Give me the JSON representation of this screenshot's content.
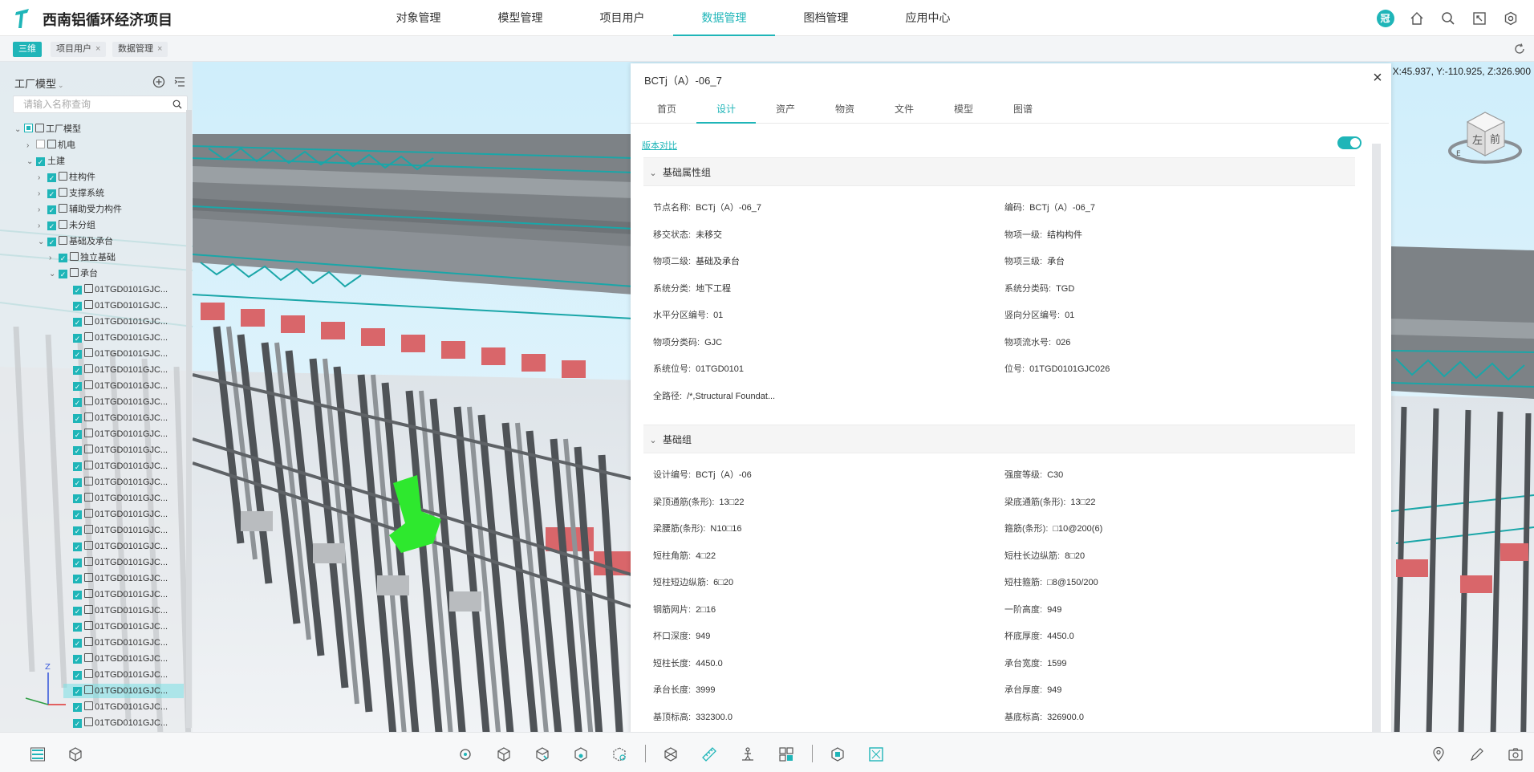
{
  "app": {
    "title": "西南铝循环经济项目"
  },
  "nav": {
    "items": [
      "对象管理",
      "模型管理",
      "项目用户",
      "数据管理",
      "图档管理",
      "应用中心"
    ],
    "active": 3
  },
  "user": {
    "badge": "冠"
  },
  "page_tabs": [
    {
      "label": "三维",
      "active": true
    },
    {
      "label": "项目用户",
      "active": false,
      "close": "×"
    },
    {
      "label": "数据管理",
      "active": false,
      "close": "×"
    }
  ],
  "viewer": {
    "coords": "X:45.937, Y:-110.925, Z:326.900"
  },
  "tree": {
    "title": "工厂模型",
    "search_placeholder": "请输入名称查询",
    "nodes": [
      {
        "label": "工厂模型"
      },
      {
        "label": "机电"
      },
      {
        "label": "土建"
      },
      {
        "label": "柱构件"
      },
      {
        "label": "支撑系统"
      },
      {
        "label": "辅助受力构件"
      },
      {
        "label": "未分组"
      },
      {
        "label": "基础及承台"
      },
      {
        "label": "独立基础"
      },
      {
        "label": "承台"
      },
      {
        "label": "01TGD0101GJC..."
      },
      {
        "label": "01TGD0101GJC..."
      },
      {
        "label": "01TGD0101GJC..."
      },
      {
        "label": "01TGD0101GJC..."
      },
      {
        "label": "01TGD0101GJC..."
      },
      {
        "label": "01TGD0101GJC..."
      },
      {
        "label": "01TGD0101GJC..."
      },
      {
        "label": "01TGD0101GJC..."
      },
      {
        "label": "01TGD0101GJC..."
      },
      {
        "label": "01TGD0101GJC..."
      },
      {
        "label": "01TGD0101GJC..."
      },
      {
        "label": "01TGD0101GJC..."
      },
      {
        "label": "01TGD0101GJC..."
      },
      {
        "label": "01TGD0101GJC..."
      },
      {
        "label": "01TGD0101GJC..."
      },
      {
        "label": "01TGD0101GJC..."
      },
      {
        "label": "01TGD0101GJC..."
      },
      {
        "label": "01TGD0101GJC..."
      },
      {
        "label": "01TGD0101GJC..."
      },
      {
        "label": "01TGD0101GJC..."
      },
      {
        "label": "01TGD0101GJC..."
      },
      {
        "label": "01TGD0101GJC..."
      },
      {
        "label": "01TGD0101GJC..."
      },
      {
        "label": "01TGD0101GJC..."
      },
      {
        "label": "01TGD0101GJC..."
      },
      {
        "label": "01TGD0101GJC..."
      },
      {
        "label": "01TGD0101GJC..."
      },
      {
        "label": "01TGD0101GJC..."
      }
    ]
  },
  "gizmo": {
    "z": "Z"
  },
  "viewcube": {
    "left": "左",
    "front": "前",
    "east": "E"
  },
  "detail": {
    "title": "BCTj（A）-06_7",
    "close": "×",
    "tabs": [
      "首页",
      "设计",
      "资产",
      "物资",
      "文件",
      "模型",
      "图谱"
    ],
    "active_tab": 1,
    "version_link": "版本对比",
    "groups": [
      {
        "title": "基础属性组",
        "props": [
          [
            "节点名称:",
            "BCTj（A）-06_7",
            "编码:",
            "BCTj（A）-06_7"
          ],
          [
            "移交状态:",
            "未移交",
            "物项一级:",
            "结构构件"
          ],
          [
            "物项二级:",
            "基础及承台",
            "物项三级:",
            "承台"
          ],
          [
            "系统分类:",
            "地下工程",
            "系统分类码:",
            "TGD"
          ],
          [
            "水平分区编号:",
            "01",
            "竖向分区编号:",
            "01"
          ],
          [
            "物项分类码:",
            "GJC",
            "物项流水号:",
            "026"
          ],
          [
            "系统位号:",
            "01TGD0101",
            "位号:",
            "01TGD0101GJC026"
          ],
          [
            "全路径:",
            "/*,Structural Foundat...",
            "",
            ""
          ]
        ]
      },
      {
        "title": "基础组",
        "props": [
          [
            "设计编号:",
            "BCTj（A）-06",
            "强度等级:",
            "C30"
          ],
          [
            "梁顶通筋(条形):",
            "13□22",
            "梁底通筋(条形):",
            "13□22"
          ],
          [
            "梁腰筋(条形):",
            "N10□16",
            "箍筋(条形):",
            "□10@200(6)"
          ],
          [
            "短柱角筋:",
            "4□22",
            "短柱长边纵筋:",
            "8□20"
          ],
          [
            "短柱短边纵筋:",
            "6□20",
            "短柱箍筋:",
            "□8@150/200"
          ],
          [
            "钢筋网片:",
            "2□16",
            "一阶高度:",
            "949"
          ],
          [
            "杯口深度:",
            "949",
            "杯底厚度:",
            "4450.0"
          ],
          [
            "短柱长度:",
            "4450.0",
            "承台宽度:",
            "1599"
          ],
          [
            "承台长度:",
            "3999",
            "承台厚度:",
            "949"
          ],
          [
            "基顶标高:",
            "332300.0",
            "基底标高:",
            "326900.0"
          ]
        ]
      }
    ]
  },
  "colors": {
    "accent": "#1fb5b8",
    "highlight_green": "#2ee82e",
    "pile_red": "#d9666a",
    "truss_teal": "#1aa6a8"
  }
}
